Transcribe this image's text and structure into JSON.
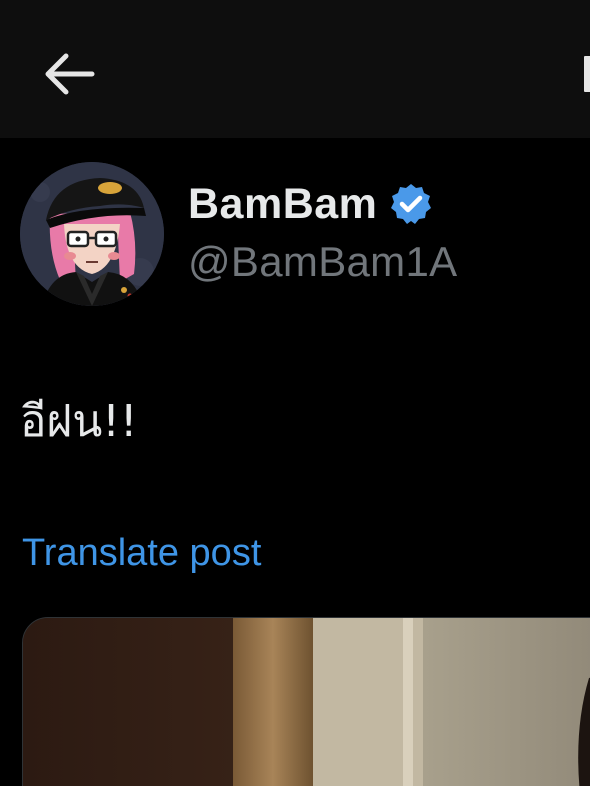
{
  "header": {
    "back_icon": "arrow-left-icon"
  },
  "author": {
    "display_name": "BamBam",
    "handle": "@BamBam1A",
    "verified_icon": "verified-badge-icon",
    "verified_color": "#4a99e9"
  },
  "post": {
    "text": "อีฝน!!",
    "translate_label": "Translate post"
  },
  "colors": {
    "background": "#000000",
    "header_background": "#0e0e0e",
    "primary_text": "#e7e9ea",
    "secondary_text": "#71767b",
    "link": "#3f95e6"
  }
}
